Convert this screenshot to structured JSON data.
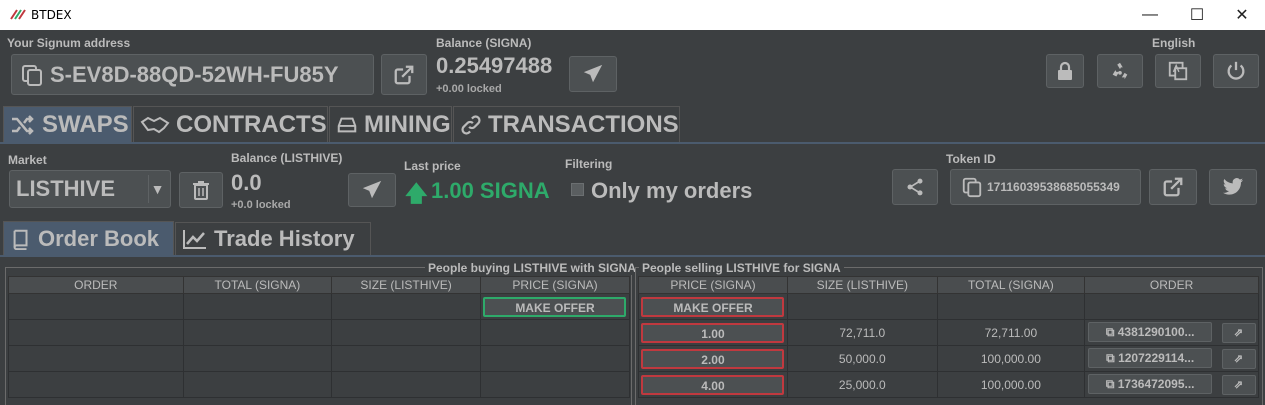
{
  "window": {
    "title": "BTDEX",
    "minimize": "—",
    "maximize": "☐",
    "close": "✕"
  },
  "header": {
    "address_label": "Your Signum address",
    "address": "S-EV8D-88QD-52WH-FU85Y",
    "balance_label": "Balance (SIGNA)",
    "balance": "0.25497488",
    "locked": "+0.00 locked",
    "language": "English"
  },
  "tabs": [
    {
      "label": "SWAPS",
      "icon": "shuffle-icon",
      "active": true
    },
    {
      "label": "CONTRACTS",
      "icon": "handshake-icon"
    },
    {
      "label": "MINING",
      "icon": "hard-drive-icon"
    },
    {
      "label": "TRANSACTIONS",
      "icon": "link-icon"
    }
  ],
  "market": {
    "market_label": "Market",
    "market_value": "LISTHIVE",
    "balance_label": "Balance (LISTHIVE)",
    "balance": "0.0",
    "locked": "+0.0 locked",
    "last_price_label": "Last price",
    "last_price": "1.00 SIGNA",
    "filtering_label": "Filtering",
    "only_my_orders": "Only my orders",
    "token_id_label": "Token ID",
    "token_id": "17116039538685055349"
  },
  "subtabs": [
    {
      "label": "Order Book",
      "icon": "book-icon",
      "active": true
    },
    {
      "label": "Trade History",
      "icon": "chart-line-icon"
    }
  ],
  "buy_panel": {
    "title": "People buying LISTHIVE with SIGNA",
    "columns": [
      "ORDER",
      "TOTAL (SIGNA)",
      "SIZE (LISTHIVE)",
      "PRICE (SIGNA)"
    ],
    "make_offer": "MAKE OFFER"
  },
  "sell_panel": {
    "title": "People selling LISTHIVE for SIGNA",
    "columns": [
      "PRICE (SIGNA)",
      "SIZE (LISTHIVE)",
      "TOTAL (SIGNA)",
      "ORDER"
    ],
    "make_offer": "MAKE OFFER",
    "rows": [
      {
        "price": "1.00",
        "size": "72,711.0",
        "total": "72,711.00",
        "order": "4381290100..."
      },
      {
        "price": "2.00",
        "size": "50,000.0",
        "total": "100,000.00",
        "order": "1207229114..."
      },
      {
        "price": "4.00",
        "size": "25,000.0",
        "total": "100,000.00",
        "order": "1736472095..."
      }
    ]
  },
  "colors": {
    "accent_green": "#2eaa6a",
    "ask_red": "#c0393f",
    "tab_active": "#4b5b6e"
  }
}
